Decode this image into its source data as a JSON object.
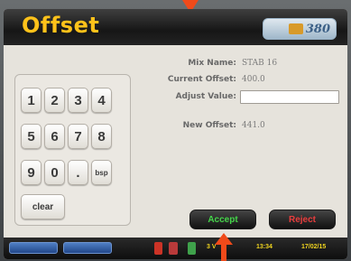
{
  "header": {
    "title": "Offset",
    "logo_text": "380"
  },
  "keypad": {
    "keys": [
      "1",
      "2",
      "3",
      "4",
      "5",
      "6",
      "7",
      "8",
      "9",
      "0",
      ".",
      "bsp"
    ],
    "clear_label": "clear"
  },
  "info": {
    "mix_name_label": "Mix Name:",
    "mix_name_value": "STAB 16",
    "current_offset_label": "Current Offset:",
    "current_offset_value": "400.0",
    "adjust_value_label": "Adjust Value:",
    "adjust_value": "",
    "new_offset_label": "New Offset:",
    "new_offset_value": "441.0"
  },
  "actions": {
    "accept_label": "Accept",
    "reject_label": "Reject"
  },
  "statusbar": {
    "time": "13:34",
    "date": "17/02/15",
    "indicator": "3 V"
  },
  "colors": {
    "title": "#ffc21a",
    "accept": "#45d64a",
    "reject": "#ea3d3d",
    "arrow": "#f04a1a"
  }
}
